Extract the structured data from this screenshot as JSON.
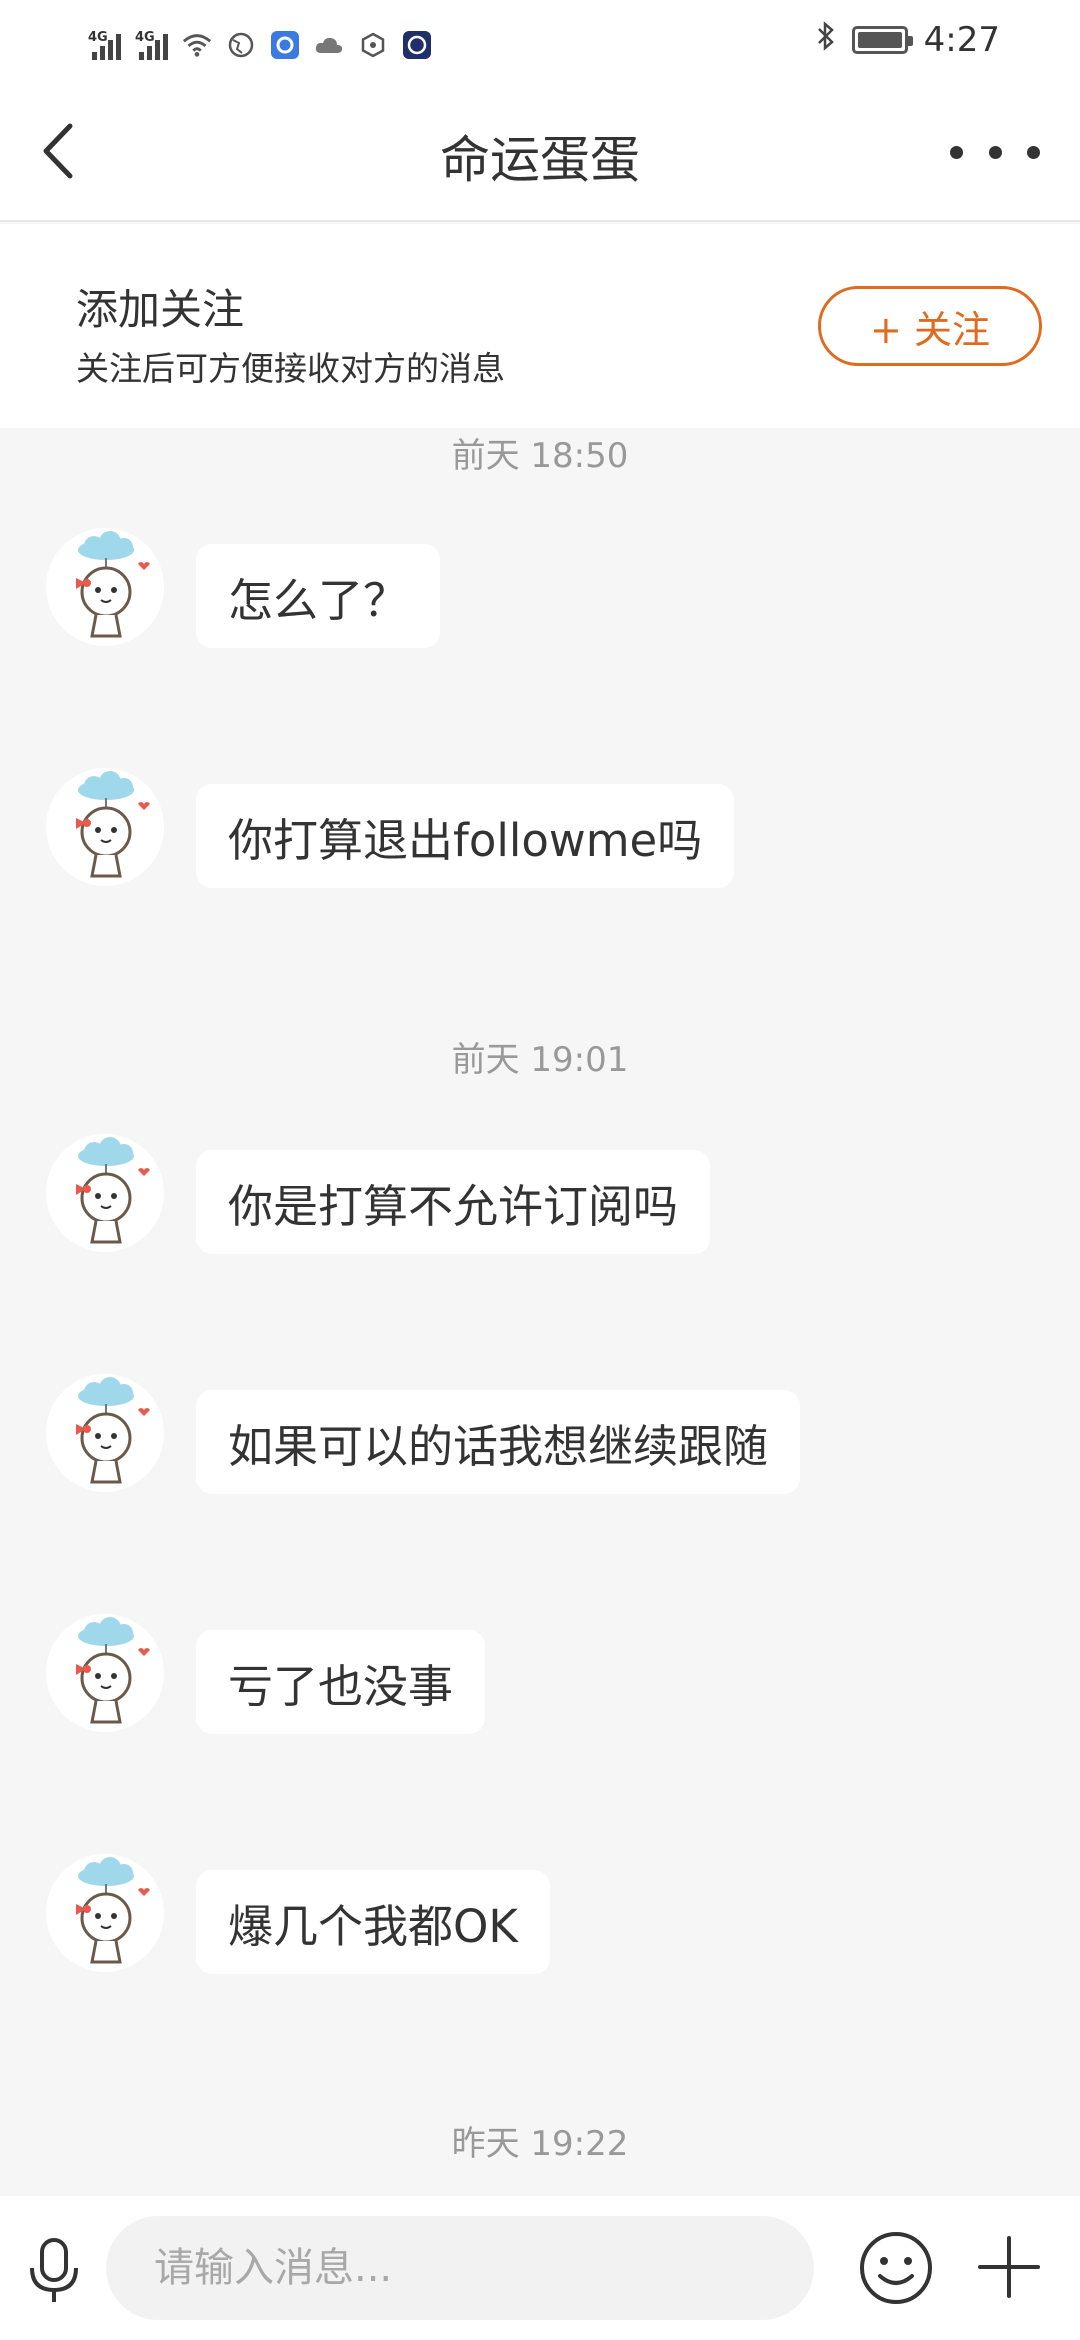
{
  "status_bar": {
    "network_1": "4G",
    "network_2": "4G",
    "time": "4:27",
    "icons": [
      "signal-icon",
      "signal-icon",
      "wifi-icon",
      "globe-icon",
      "app-icon",
      "cloud-icon",
      "hexagon-icon",
      "app-icon",
      "bluetooth-icon",
      "battery-icon"
    ]
  },
  "header": {
    "title": "命运蛋蛋",
    "back_icon": "chevron-left-icon",
    "more_icon": "more-horizontal-icon"
  },
  "follow_banner": {
    "title": "添加关注",
    "subtitle": "关注后可方便接收对方的消息",
    "button_label": "+ 关注"
  },
  "chat": {
    "timestamps": [
      "前天 18:50",
      "前天 19:01",
      "昨天 19:22"
    ],
    "messages": [
      {
        "text": "怎么了？"
      },
      {
        "text": "你打算退出followme吗"
      },
      {
        "text": "你是打算不允许订阅吗"
      },
      {
        "text": "如果可以的话我想继续跟随"
      },
      {
        "text": "亏了也没事"
      },
      {
        "text": "爆几个我都OK"
      }
    ]
  },
  "input_bar": {
    "placeholder": "请输入消息...",
    "mic_icon": "microphone-icon",
    "emoji_icon": "smiley-icon",
    "plus_icon": "plus-icon"
  },
  "colors": {
    "accent": "#e06b1f",
    "background": "#f6f6f6",
    "bubble": "#ffffff",
    "timestamp": "#999999"
  }
}
